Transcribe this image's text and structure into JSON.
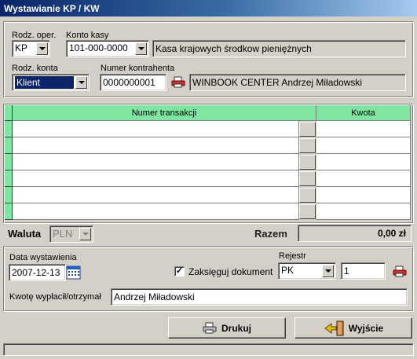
{
  "window": {
    "title": "Wystawianie KP / KW"
  },
  "header": {
    "op_type_label": "Rodz. oper.",
    "op_type_value": "KP",
    "cash_account_label": "Konto kasy",
    "cash_account_value": "101-000-0000",
    "cash_account_name": "Kasa krajowych środkow pieniężnych",
    "account_type_label": "Rodz. konta",
    "account_type_value": "Klient",
    "contractor_number_label": "Numer kontrahenta",
    "contractor_number_value": "0000000001",
    "contractor_name": "WINBOOK CENTER  Andrzej Miładowski"
  },
  "grid": {
    "columns": [
      "Numer transakcji",
      "Kwota"
    ],
    "rows": [
      {
        "transaction": "",
        "amount": ""
      },
      {
        "transaction": "",
        "amount": ""
      },
      {
        "transaction": "",
        "amount": ""
      },
      {
        "transaction": "",
        "amount": ""
      },
      {
        "transaction": "",
        "amount": ""
      },
      {
        "transaction": "",
        "amount": ""
      }
    ]
  },
  "summary": {
    "currency_label": "Waluta",
    "currency_value": "PLN",
    "total_label": "Razem",
    "total_value": "0,00 zł"
  },
  "details": {
    "issue_date_label": "Data wystawienia",
    "issue_date_value": "2007-12-13",
    "post_document_label": "Zaksięguj dokument",
    "post_document_checked": true,
    "register_label": "Rejestr",
    "register_value": "PK",
    "register_number": "1",
    "payee_label": "Kwotę wypłacił/otrzymał",
    "payee_value": "Andrzej Miładowski"
  },
  "actions": {
    "print_label": "Drukuj",
    "exit_label": "Wyjście"
  },
  "colors": {
    "grid_header": "#7ee6a0",
    "title_bar": "#0a246a",
    "selection": "#0a246a"
  },
  "icons": [
    "printer-icon",
    "calendar-icon",
    "exit-door-icon",
    "lookup-icon"
  ]
}
